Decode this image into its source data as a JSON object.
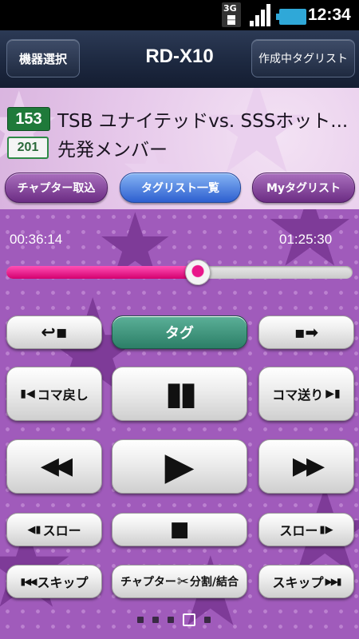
{
  "status_bar": {
    "network": "3G",
    "time": "12:34"
  },
  "header": {
    "device_select_label": "機器選択",
    "title": "RD-X10",
    "taglist_in_progress_label": "作成中タグリスト"
  },
  "program": {
    "channel_main": "153",
    "title_main": "TSB ユナイテッドvs. SSSホット...",
    "channel_sub": "201",
    "title_sub": "先発メンバー"
  },
  "tabs": [
    {
      "label": "チャプター取込"
    },
    {
      "label": "タグリスト一覧"
    },
    {
      "label": "Myタグリスト"
    }
  ],
  "playback": {
    "elapsed": "00:36:14",
    "total": "01:25:30",
    "progress": 0.55
  },
  "controls": {
    "back_label": "",
    "tag_label": "タグ",
    "forward_label": "",
    "frame_back_label": "コマ戻し",
    "pause_label": "",
    "frame_forward_label": "コマ送り",
    "rewind_label": "",
    "play_label": "",
    "fast_forward_label": "",
    "slow_back_label": "スロー",
    "stop_label": "",
    "slow_forward_label": "スロー",
    "skip_back_label": "スキップ",
    "chapter_split_label": "チャプター",
    "chapter_split_suffix": "分割/結合",
    "skip_forward_label": "スキップ"
  },
  "pager": {
    "count": 5,
    "active_index": 3
  },
  "icons": {
    "back": "return-arrow-icon",
    "forward": "arrow-right-icon",
    "frame_back": "frame-back-icon",
    "pause": "pause-icon",
    "frame_forward": "frame-forward-icon",
    "rewind": "rewind-icon",
    "play": "play-icon",
    "fast_forward": "fast-forward-icon",
    "slow_back": "slow-back-icon",
    "stop": "stop-icon",
    "slow_forward": "slow-forward-icon",
    "skip_back": "skip-back-icon",
    "scissors": "scissors-icon",
    "skip_forward": "skip-forward-icon"
  },
  "colors": {
    "accent_pink": "#e9178a",
    "tag_green": "#2c7f67",
    "channel_green": "#1f7a3a",
    "tab_blue": "#2d5fd0",
    "tab_purple": "#6c2d84"
  }
}
